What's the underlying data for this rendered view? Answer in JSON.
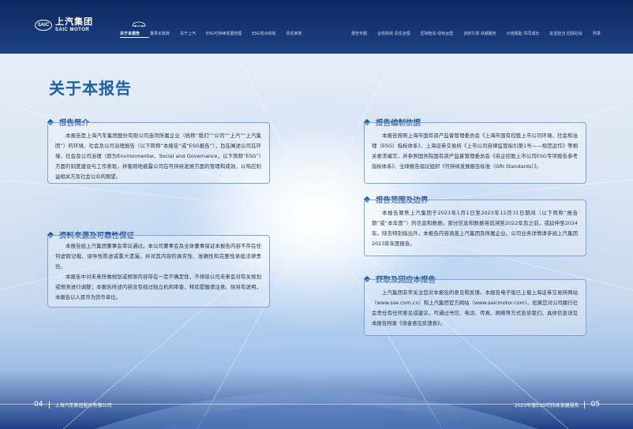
{
  "header": {
    "logo_badge": "SAIC",
    "logo_cn": "上汽集团",
    "logo_en": "SAIC MOTOR",
    "nav_left": [
      "关于本报告",
      "董事长致辞",
      "关于上汽",
      "ESG可持续发展管理",
      "ESG亮点绩效",
      "责任荣誉"
    ],
    "nav_right": [
      "报告专题",
      "合规高效 责任治理",
      "匠制智造 绿色运营",
      "创新引领 卓越服务",
      "价值赋能 共同成长",
      "彰显担当 回馈社会",
      "附录"
    ]
  },
  "page_title": "关于本报告",
  "sections": {
    "intro": {
      "title": "报告简介",
      "paragraphs": [
        "本报告是上海汽车集团股份有限公司连同所属企业（统称“我们”“公司”“上汽”“上汽集团”）的环境、社会及公司治理报告（以下简称“本报告”或“ESG报告”），旨在阐述公司在环境、社会及公司治理（即为Environmental、Social and Governance，以下简称“ESG”）方面的制度建设与工作表现，并客观地披露公司在可持续发展方面的管理和成效，以响应利益相关方及社会公众的期望。"
      ]
    },
    "source": {
      "title": "资料来源及可靠性保证",
      "paragraphs": [
        "本报告经上汽集团董事会审议通过。本公司董事会及全体董事保证本报告内容不存在任何虚假记载、误导性陈述或重大遗漏，并对其内容的真实性、准确性和完整性承担法律责任。",
        "本报告中对未来所做规划或预测内容存在一定不确定性，不排除公司未来会对有关规划或预测进行调整；本报告所述内容没有经过独立机构审查，特此提醒请注意。除另有说明，本报告以人民币为货币单位。"
      ]
    },
    "basis": {
      "title": "报告编制依据",
      "paragraphs": [
        "本报告按照上海市国有资产监督管理委员会《上海市国有控股上市公司环境、社会和治理（ESG）指标体系》、上海证券交易所《上市公司自律监管指引第1号——规范运作》等相关要求编写，并参照国务院国有资产监督管理委员会《央企控股上市公司ESG专项报告参考指标体系》、全球报告倡议组织《可持续发展报告标准（GRI Standards）》。"
      ]
    },
    "scope": {
      "title": "报告范围及边界",
      "paragraphs": [
        "本报告聚焦上汽集团于2023年1月1日至2023年12月31日期间（以下简称“报告期”或“本年度”）的信息和数据。部分信息和数据将追溯至2022年及之前，或延伸至2024年。除去特别指出外，本报告内容涵盖上汽集团及所属企业。公司业务详情请参阅上汽集团2023年年度报告。"
      ]
    },
    "feedback": {
      "title": "获取及回应本报告",
      "paragraphs": [
        "上汽集团非常关注您对本报告的意见和反馈。本报告电子版已上载上海证券交易所网站（www.sse.com.cn）和上汽集团官方网站（www.saicmotor.com）。如果您对公司履行社会责任有任何意见或建议，可通过书信、电话、传真、网络等方式告诉我们。具体信息详见本报告附录《读者意见反馈表》。"
      ]
    }
  },
  "footer": {
    "left_page": "04",
    "left_text": "上海汽车集团股份有限公司",
    "right_text": "2023年度ESG可持续发展报告",
    "right_page": "05"
  },
  "colors": {
    "header_bg": "#173777",
    "title_blue": "#1f5ea8",
    "box_border": "#7fa3d6"
  }
}
